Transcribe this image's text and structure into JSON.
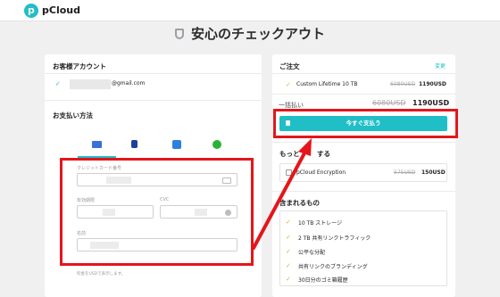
{
  "header": {
    "logo_letter": "p",
    "brand": "pCloud"
  },
  "page_title": "安心のチェックアウト",
  "account": {
    "title": "お客様アカウント",
    "email_suffix": "@gmail.com"
  },
  "payment": {
    "title": "お支払い方法",
    "tabs": [
      {
        "icon": "credit-card-icon",
        "color": "#3b6fd9"
      },
      {
        "icon": "paypal-icon",
        "color": "#1f3f99"
      },
      {
        "icon": "bank-transfer-icon",
        "color": "#2f7fe0"
      },
      {
        "icon": "wechat-pay-icon",
        "color": "#2ab234"
      }
    ],
    "card_number_label": "クレジットカード番号",
    "expiry_label": "有効期限",
    "cvc_label": "CVC",
    "name_label": "名前",
    "note": "料金をUSDで表示します。"
  },
  "order": {
    "title": "ご注文",
    "change_label": "変更",
    "item_name": "Custom Lifetime 10 TB",
    "item_old_price": "6080USD",
    "item_price": "1190USD",
    "total_label": "一括払い",
    "total_old_price": "6080USD",
    "total_price": "1190USD",
    "pay_button": "今すぐ支払う"
  },
  "addons": {
    "title_left": "もっと",
    "title_right": "する",
    "item_name": "pCloud Encryption",
    "item_old_price": "575USD",
    "item_price": "150USD"
  },
  "included": {
    "title": "含まれるもの",
    "items": [
      "10 TB ストレージ",
      "2 TB 共有リンクトラフィック",
      "公平な分配",
      "共有リンクのブランディング",
      "30日分のゴミ箱履歴"
    ]
  },
  "colors": {
    "accent": "#20bec6",
    "annotation_red": "#e4161b",
    "item_check": "#e8a83c"
  }
}
